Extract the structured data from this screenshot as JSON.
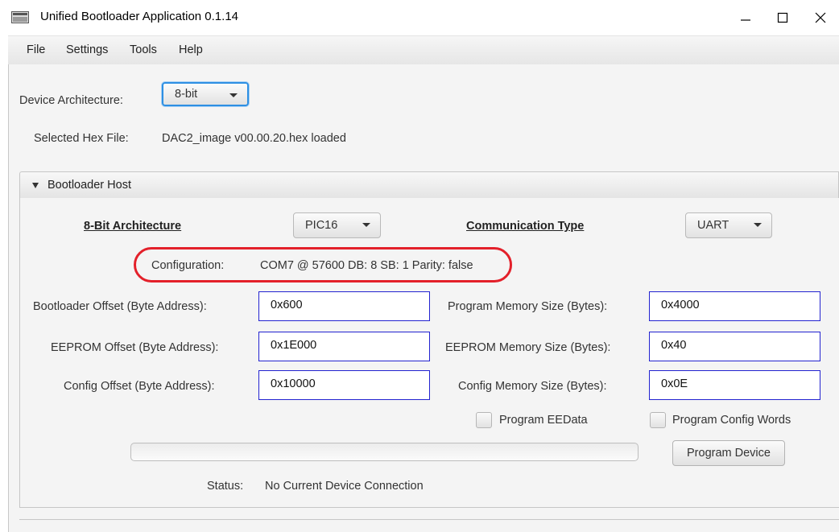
{
  "window": {
    "title": "Unified Bootloader Application 0.1.14",
    "controls": {
      "minimize": "—",
      "maximize": "☐",
      "close": "✕"
    },
    "icon": "app-window-icon"
  },
  "menu": {
    "items": [
      "File",
      "Settings",
      "Tools",
      "Help"
    ]
  },
  "device_architecture": {
    "label": "Device Architecture:",
    "value": "8-bit"
  },
  "hex_file": {
    "label": "Selected Hex File:",
    "value": "DAC2_image v00.00.20.hex loaded"
  },
  "bootloader_host": {
    "title": "Bootloader Host",
    "architecture_label": "8-Bit Architecture",
    "architecture_value": "PIC16",
    "comm_type_label": "Communication Type",
    "comm_type_value": "UART",
    "configuration_label": "Configuration:",
    "configuration_value": "COM7 @ 57600 DB: 8 SB: 1 Parity: false",
    "bootloader_offset": {
      "label": "Bootloader Offset (Byte Address):",
      "value": "0x600"
    },
    "eeprom_offset": {
      "label": "EEPROM Offset (Byte Address):",
      "value": "0x1E000"
    },
    "config_offset": {
      "label": "Config Offset (Byte Address):",
      "value": "0x10000"
    },
    "program_memory_size": {
      "label": "Program Memory Size (Bytes):",
      "value": "0x4000"
    },
    "eeprom_memory_size": {
      "label": "EEPROM Memory Size (Bytes):",
      "value": "0x40"
    },
    "config_memory_size": {
      "label": "Config Memory Size (Bytes):",
      "value": "0x0E"
    },
    "program_eedata_label": "Program EEData",
    "program_config_words_label": "Program Config Words",
    "program_device_label": "Program Device",
    "status_label": "Status:",
    "status_value": "No Current Device Connection",
    "progress": 0
  },
  "colors": {
    "annotation": "#e3202a",
    "field_border": "#2222d0",
    "focus": "#2d8fe3"
  }
}
